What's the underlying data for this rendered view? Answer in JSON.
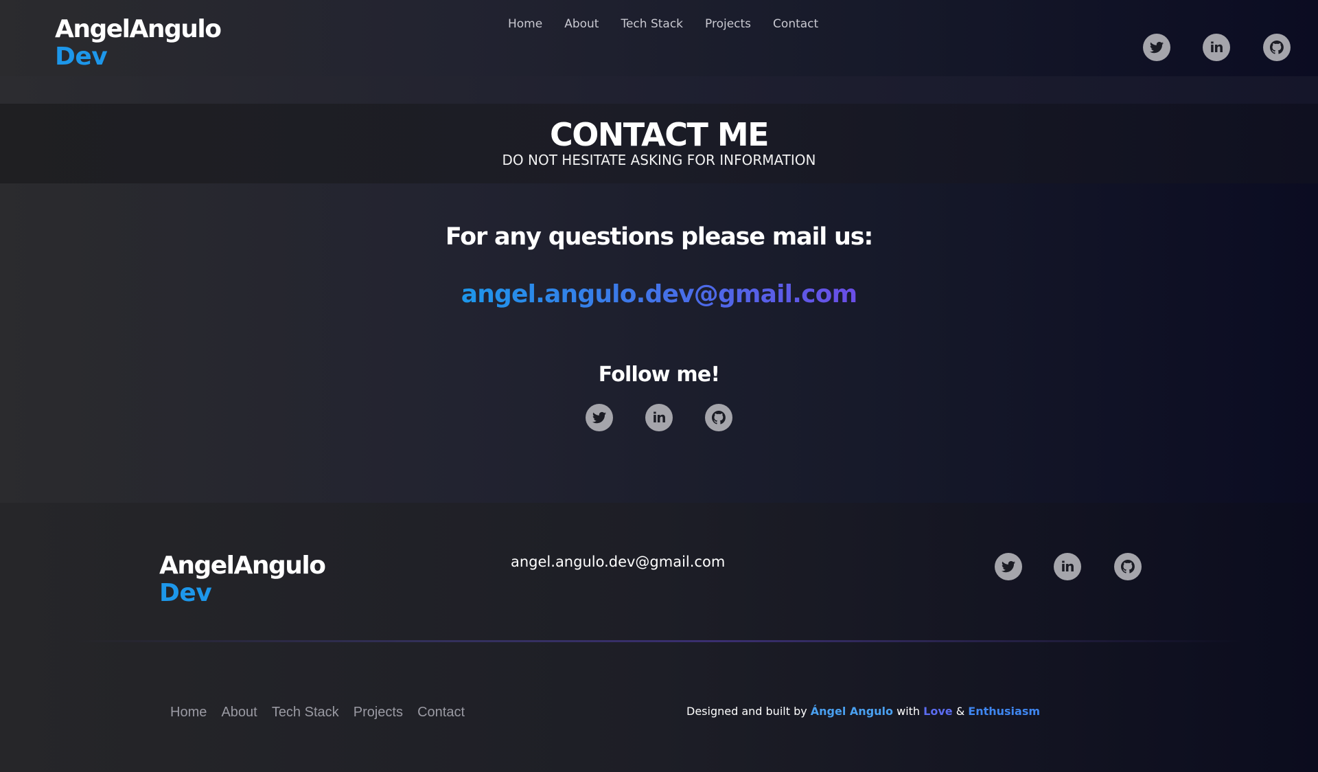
{
  "header": {
    "logo_main": "AngelAngulo",
    "logo_dev": "Dev",
    "nav": [
      "Home",
      "About",
      "Tech Stack",
      "Projects",
      "Contact"
    ]
  },
  "social_icons": [
    "twitter-icon",
    "linkedin-icon",
    "github-icon"
  ],
  "linkedin_glyph": "in",
  "hero": {
    "title": "CONTACT ME",
    "subtitle": "DO NOT HESITATE ASKING FOR INFORMATION"
  },
  "contact": {
    "question": "For any questions please mail us:",
    "email": "angel.angulo.dev@gmail.com",
    "follow": "Follow me!"
  },
  "footer": {
    "logo_main": "AngelAngulo",
    "logo_dev": "Dev",
    "email": "angel.angulo.dev@gmail.com",
    "nav": [
      "Home",
      "About",
      "Tech Stack",
      "Projects",
      "Contact"
    ],
    "credit": {
      "prefix": "Designed and built by ",
      "name": "Ángel Angulo",
      "with": " with ",
      "love": "Love",
      "amp": " & ",
      "enthusiasm": "Enthusiasm"
    }
  },
  "colors": {
    "accent_blue": "#1d97ea",
    "accent_purple": "#6a4ee6",
    "icon_fill": "#a5a5ab"
  }
}
